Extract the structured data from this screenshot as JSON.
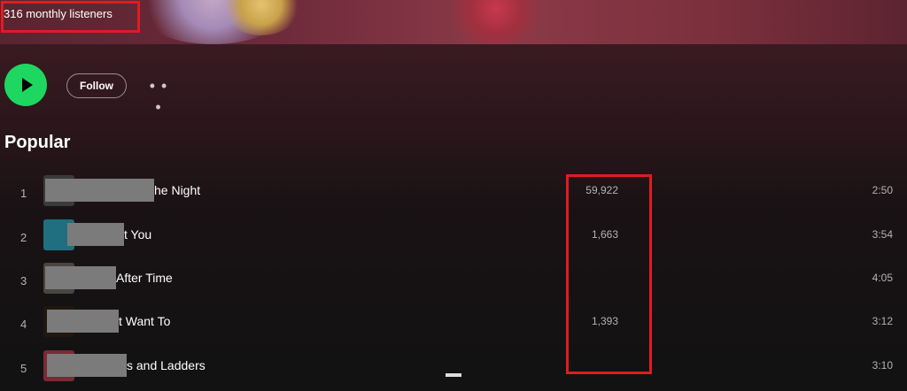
{
  "artist": {
    "monthly_listeners": "316 monthly listeners"
  },
  "actions": {
    "play_icon": "play-icon",
    "follow_label": "Follow",
    "more_label": "• • •"
  },
  "popular": {
    "title": "Popular",
    "tracks": [
      {
        "rank": "1",
        "title": "he Night",
        "plays": "59,922",
        "duration": "2:50"
      },
      {
        "rank": "2",
        "title": "t You",
        "plays": "1,663",
        "duration": "3:54"
      },
      {
        "rank": "3",
        "title": "After Time",
        "plays": "",
        "duration": "4:05"
      },
      {
        "rank": "4",
        "title": "t Want To",
        "plays": "1,393",
        "duration": "3:12"
      },
      {
        "rank": "5",
        "title": "s and Ladders",
        "plays": "",
        "duration": "3:10"
      }
    ]
  },
  "colors": {
    "accent": "#1ed760",
    "highlight": "#e11b22"
  }
}
